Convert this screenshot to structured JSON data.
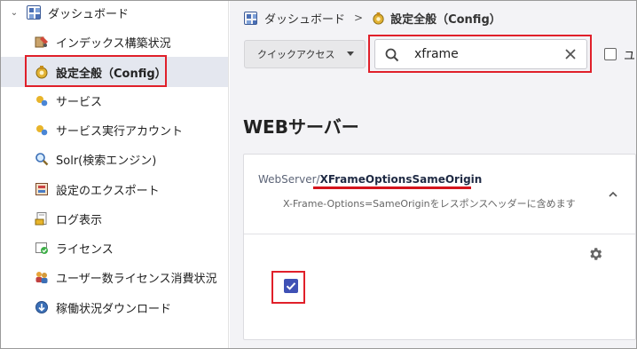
{
  "sidebar": {
    "root": {
      "label": "ダッシュボード",
      "chevron": "chevron-down-icon"
    },
    "items": [
      {
        "label": "インデックス構築状況",
        "icon": "index-build-icon"
      },
      {
        "label": "設定全般（Config）",
        "icon": "config-icon",
        "selected": true
      },
      {
        "label": "サービス",
        "icon": "service-icon"
      },
      {
        "label": "サービス実行アカウント",
        "icon": "service-account-icon"
      },
      {
        "label": "Solr(検索エンジン)",
        "icon": "search-engine-icon"
      },
      {
        "label": "設定のエクスポート",
        "icon": "export-icon"
      },
      {
        "label": "ログ表示",
        "icon": "log-icon"
      },
      {
        "label": "ライセンス",
        "icon": "license-icon"
      },
      {
        "label": "ユーザー数ライセンス消費状況",
        "icon": "user-license-icon"
      },
      {
        "label": "稼働状況ダウンロード",
        "icon": "download-icon"
      }
    ]
  },
  "breadcrumb": {
    "root": "ダッシュボード",
    "separator": ">",
    "current": "設定全般（Config）"
  },
  "toolbar": {
    "quick_access_label": "クイックアクセス",
    "search_value": "xframe",
    "checkbox_label": "ユ"
  },
  "section": {
    "title": "WEBサーバー"
  },
  "property": {
    "prefix": "WebServer/",
    "key": "XFrameOptionsSameOrigin",
    "description": "X-Frame-Options=SameOriginをレスポンスヘッダーに含めます",
    "checked": true
  },
  "colors": {
    "highlight": "#e0202a",
    "accent": "#3f51b5",
    "selected_bg": "#e4e7ef"
  }
}
